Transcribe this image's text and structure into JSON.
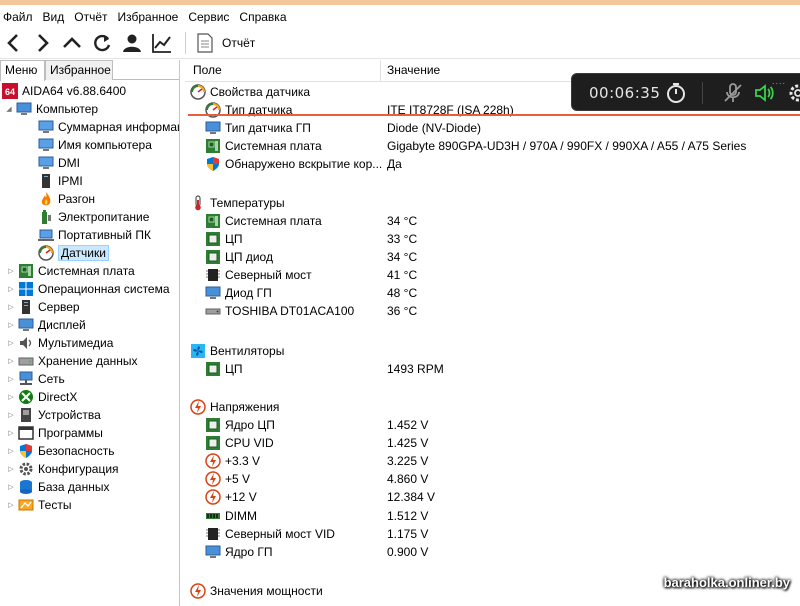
{
  "menubar": [
    "Файл",
    "Вид",
    "Отчёт",
    "Избранное",
    "Сервис",
    "Справка"
  ],
  "toolbar": {
    "report_label": "Отчёт"
  },
  "left_tabs": {
    "menu": "Меню",
    "favorites": "Избранное"
  },
  "tree": {
    "root": "AIDA64 v6.88.6400",
    "root_badge": "64",
    "computer": "Компьютер",
    "computer_children": [
      "Суммарная информация",
      "Имя компьютера",
      "DMI",
      "IPMI",
      "Разгон",
      "Электропитание",
      "Портативный ПК",
      "Датчики"
    ],
    "categories": [
      "Системная плата",
      "Операционная система",
      "Сервер",
      "Дисплей",
      "Мультимедиа",
      "Хранение данных",
      "Сеть",
      "DirectX",
      "Устройства",
      "Программы",
      "Безопасность",
      "Конфигурация",
      "База данных",
      "Тесты"
    ]
  },
  "columns": {
    "field": "Поле",
    "value": "Значение"
  },
  "sections": {
    "sensor_props": {
      "title": "Свойства датчика",
      "rows": [
        {
          "field": "Тип датчика",
          "value": "ITE IT8728F  (ISA 228h)"
        },
        {
          "field": "Тип датчика ГП",
          "value": "Diode  (NV-Diode)"
        },
        {
          "field": "Системная плата",
          "value": "Gigabyte 890GPA-UD3H / 970A / 990FX / 990XA / A55 / A75 Series"
        },
        {
          "field": "Обнаружено вскрытие кор...",
          "value": "Да"
        }
      ]
    },
    "temps": {
      "title": "Температуры",
      "rows": [
        {
          "field": "Системная плата",
          "value": "34 °C"
        },
        {
          "field": "ЦП",
          "value": "33 °C"
        },
        {
          "field": "ЦП диод",
          "value": "34 °C"
        },
        {
          "field": "Северный мост",
          "value": "41 °C"
        },
        {
          "field": "Диод ГП",
          "value": "48 °C"
        },
        {
          "field": "TOSHIBA DT01ACA100",
          "value": "36 °C"
        }
      ]
    },
    "fans": {
      "title": "Вентиляторы",
      "rows": [
        {
          "field": "ЦП",
          "value": "1493 RPM"
        }
      ]
    },
    "voltages": {
      "title": "Напряжения",
      "rows": [
        {
          "field": "Ядро ЦП",
          "value": "1.452 V"
        },
        {
          "field": "CPU VID",
          "value": "1.425 V"
        },
        {
          "field": "+3.3 V",
          "value": "3.225 V"
        },
        {
          "field": "+5 V",
          "value": "4.860 V"
        },
        {
          "field": "+12 V",
          "value": "12.384 V"
        },
        {
          "field": "DIMM",
          "value": "1.512 V"
        },
        {
          "field": "Северный мост VID",
          "value": "1.175 V"
        },
        {
          "field": "Ядро ГП",
          "value": "0.900 V"
        }
      ]
    },
    "power": {
      "title": "Значения мощности"
    }
  },
  "overlay": {
    "time": "00:06:35",
    "dots": "...."
  },
  "watermark": "baraholka.onliner.by",
  "colors": {
    "selection": "#cce8ff",
    "accent_line": "#e8603a",
    "overlay_bg": "#1e1e1e",
    "speaker_green": "#39d24a"
  }
}
